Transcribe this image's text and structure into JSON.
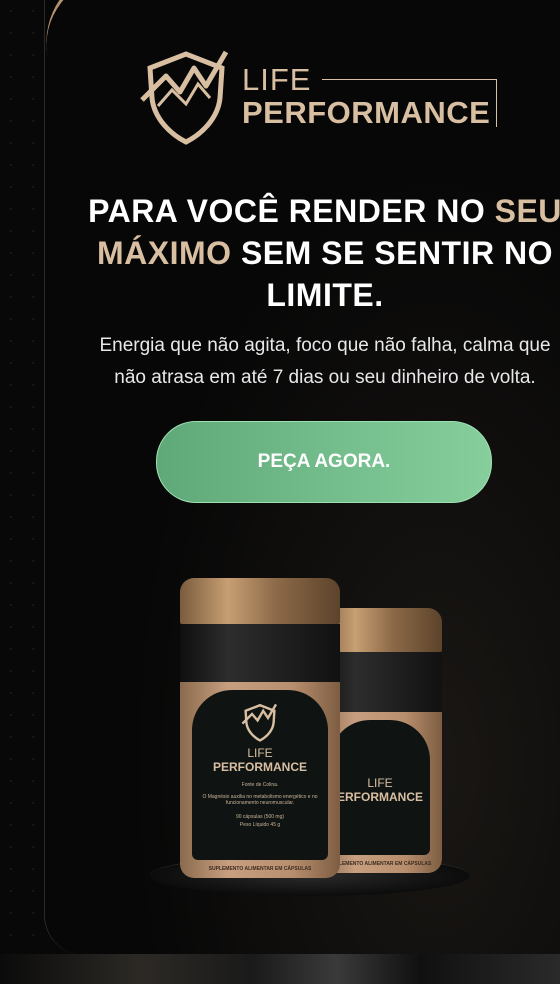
{
  "brand": {
    "life": "LIFE",
    "performance": "PERFORMANCE"
  },
  "hero": {
    "headline_part1": "PARA VOCÊ RENDER NO ",
    "headline_gold1": "SEU",
    "headline_gold2": "MÁXIMO",
    "headline_part2": " SEM SE SENTIR NO",
    "headline_part3": "LIMITE.",
    "subtitle_line1": "Energia que não agita, foco que não falha, calma que",
    "subtitle_line2": "não atrasa em até 7 dias ou seu dinheiro de volta."
  },
  "cta": {
    "label": "PEÇA AGORA."
  },
  "product_label": {
    "life": "LIFE",
    "performance": "PERFORMANCE",
    "performance_partial": "ERFORMANCE",
    "line1": "Fonte de Colina.",
    "line2": "O Magnésio auxilia no metabolismo energético e no funcionamento neuromuscular.",
    "line3": "90 cápsulas (500 mg)",
    "line4": "Peso Líquido 45 g",
    "footer": "SUPLEMENTO ALIMENTAR EM CÁPSULAS"
  },
  "colors": {
    "background": "#070707",
    "gold": "#d9bfa2",
    "cta_start": "#5fa878",
    "cta_end": "#86cf9d"
  }
}
